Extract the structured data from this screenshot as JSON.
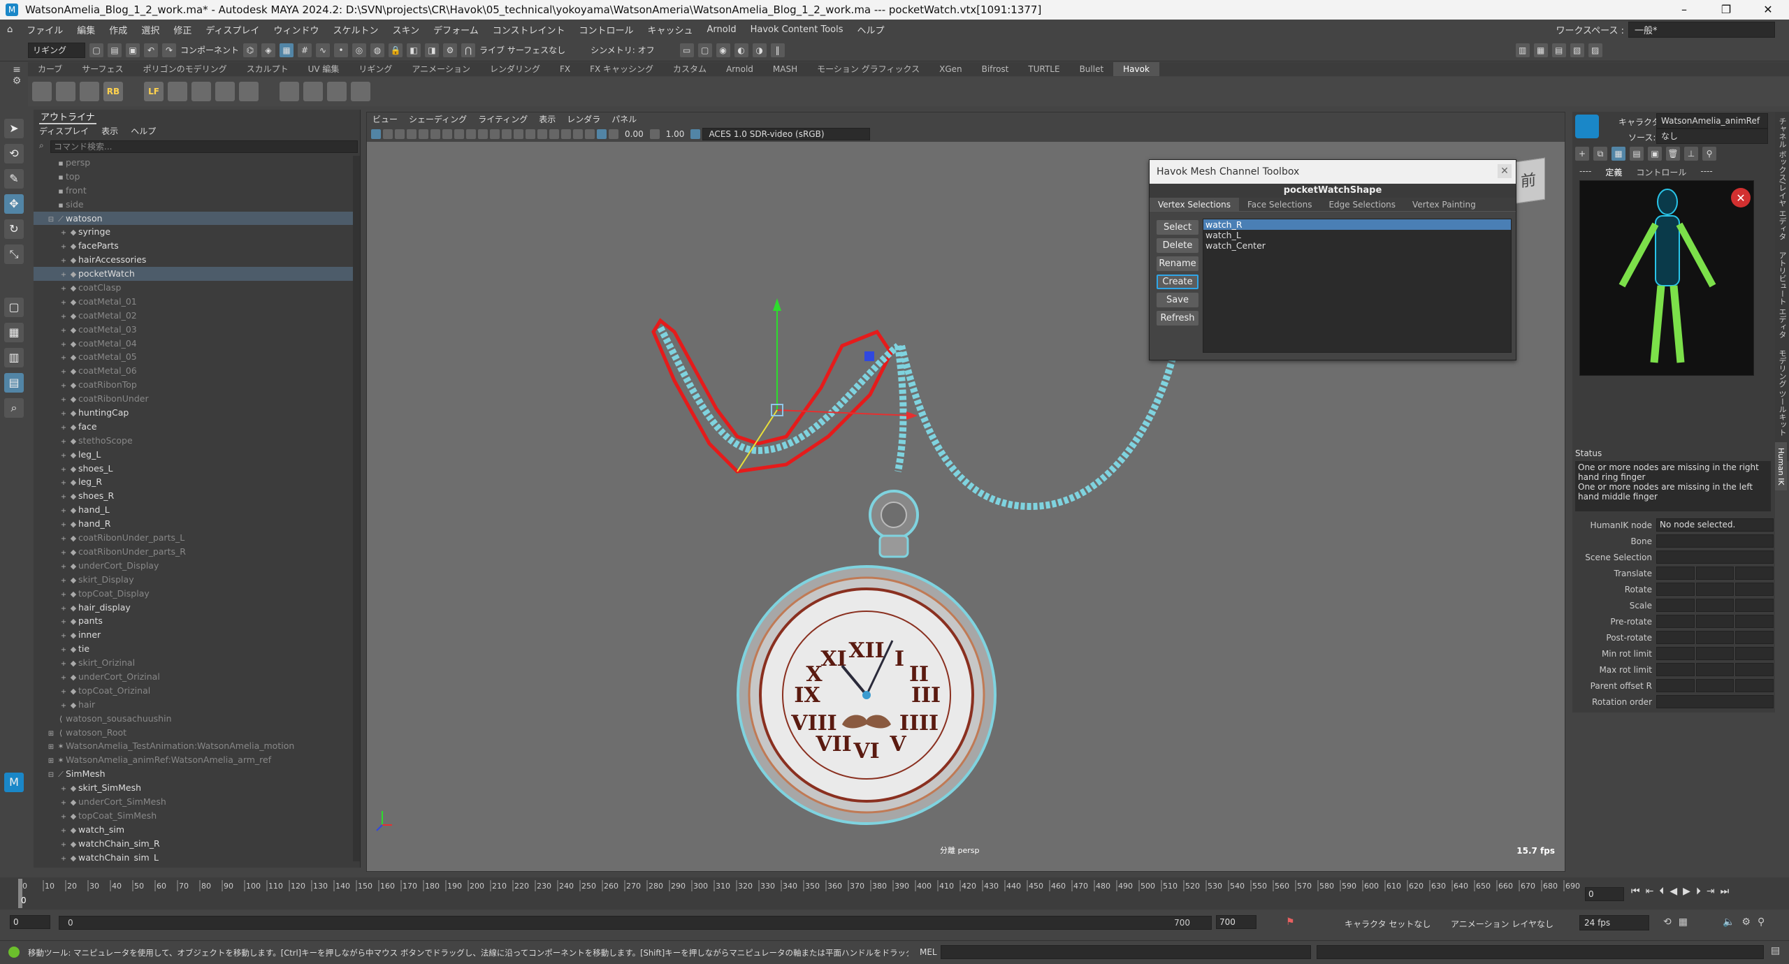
{
  "window": {
    "title": "WatsonAmelia_Blog_1_2_work.ma* - Autodesk MAYA 2024.2: D:\\SVN\\projects\\CR\\Havok\\05_technical\\yokoyama\\WatsonAmeria\\WatsonAmelia_Blog_1_2_work.ma   ---   pocketWatch.vtx[1091:1377]",
    "controls": [
      "–",
      "❐",
      "✕"
    ]
  },
  "menubar": {
    "items": [
      "ファイル",
      "編集",
      "作成",
      "選択",
      "修正",
      "ディスプレイ",
      "ウィンドウ",
      "スケルトン",
      "スキン",
      "デフォーム",
      "コンストレイント",
      "コントロール",
      "キャッシュ",
      "Arnold",
      "Havok Content Tools",
      "ヘルプ"
    ],
    "workspace_label": "ワークスペース :",
    "workspace_value": "一般*"
  },
  "statusline": {
    "mode": "リギング",
    "component_label": "コンポーネント",
    "live_surface": "ライブ サーフェスなし",
    "symmetry": "シンメトリ: オフ"
  },
  "shelf": {
    "tabs": [
      "カーブ",
      "サーフェス",
      "ポリゴンのモデリング",
      "スカルプト",
      "UV 編集",
      "リギング",
      "アニメーション",
      "レンダリング",
      "FX",
      "FX キャッシング",
      "カスタム",
      "Arnold",
      "MASH",
      "モーション グラフィックス",
      "XGen",
      "Bifrost",
      "TURTLE",
      "Bullet",
      "Havok"
    ],
    "active_tab": "Havok",
    "icons": [
      "skeleton-icon",
      "skin-icon",
      "joint-icon",
      "rb-icon",
      "lf-icon",
      "havok-icon",
      "ring-icon",
      "clip-icon",
      "chart-icon",
      "sim-icon",
      "ball-icon",
      "mesh-icon",
      "grid-icon"
    ],
    "icon_labels": [
      "RB",
      "LF"
    ]
  },
  "outliner": {
    "tab": "アウトライナ",
    "menu": [
      "ディスプレイ",
      "表示",
      "ヘルプ"
    ],
    "search_placeholder": "コマンド検索...",
    "rows": [
      {
        "label": "persp",
        "indent": 0,
        "dim": true,
        "icon": "camera",
        "exp": ""
      },
      {
        "label": "top",
        "indent": 0,
        "dim": true,
        "icon": "camera",
        "exp": ""
      },
      {
        "label": "front",
        "indent": 0,
        "dim": true,
        "icon": "camera",
        "exp": ""
      },
      {
        "label": "side",
        "indent": 0,
        "dim": true,
        "icon": "camera",
        "exp": ""
      },
      {
        "label": "watoson",
        "indent": 0,
        "dim": false,
        "icon": "joint",
        "exp": "⊟",
        "sel": true
      },
      {
        "label": "syringe",
        "indent": 1,
        "dim": false,
        "icon": "mesh",
        "exp": "+"
      },
      {
        "label": "faceParts",
        "indent": 1,
        "dim": false,
        "icon": "mesh",
        "exp": "+"
      },
      {
        "label": "hairAccessories",
        "indent": 1,
        "dim": false,
        "icon": "mesh",
        "exp": "+"
      },
      {
        "label": "pocketWatch",
        "indent": 1,
        "dim": false,
        "icon": "mesh",
        "exp": "+",
        "sel": true
      },
      {
        "label": "coatClasp",
        "indent": 1,
        "dim": true,
        "icon": "mesh",
        "exp": "+"
      },
      {
        "label": "coatMetal_01",
        "indent": 1,
        "dim": true,
        "icon": "mesh",
        "exp": "+"
      },
      {
        "label": "coatMetal_02",
        "indent": 1,
        "dim": true,
        "icon": "mesh",
        "exp": "+"
      },
      {
        "label": "coatMetal_03",
        "indent": 1,
        "dim": true,
        "icon": "mesh",
        "exp": "+"
      },
      {
        "label": "coatMetal_04",
        "indent": 1,
        "dim": true,
        "icon": "mesh",
        "exp": "+"
      },
      {
        "label": "coatMetal_05",
        "indent": 1,
        "dim": true,
        "icon": "mesh",
        "exp": "+"
      },
      {
        "label": "coatMetal_06",
        "indent": 1,
        "dim": true,
        "icon": "mesh",
        "exp": "+"
      },
      {
        "label": "coatRibonTop",
        "indent": 1,
        "dim": true,
        "icon": "mesh",
        "exp": "+"
      },
      {
        "label": "coatRibonUnder",
        "indent": 1,
        "dim": true,
        "icon": "mesh",
        "exp": "+"
      },
      {
        "label": "huntingCap",
        "indent": 1,
        "dim": false,
        "icon": "mesh",
        "exp": "+"
      },
      {
        "label": "face",
        "indent": 1,
        "dim": false,
        "icon": "mesh",
        "exp": "+"
      },
      {
        "label": "stethoScope",
        "indent": 1,
        "dim": true,
        "icon": "mesh",
        "exp": "+"
      },
      {
        "label": "leg_L",
        "indent": 1,
        "dim": false,
        "icon": "mesh",
        "exp": "+"
      },
      {
        "label": "shoes_L",
        "indent": 1,
        "dim": false,
        "icon": "mesh",
        "exp": "+"
      },
      {
        "label": "leg_R",
        "indent": 1,
        "dim": false,
        "icon": "mesh",
        "exp": "+"
      },
      {
        "label": "shoes_R",
        "indent": 1,
        "dim": false,
        "icon": "mesh",
        "exp": "+"
      },
      {
        "label": "hand_L",
        "indent": 1,
        "dim": false,
        "icon": "mesh",
        "exp": "+"
      },
      {
        "label": "hand_R",
        "indent": 1,
        "dim": false,
        "icon": "mesh",
        "exp": "+"
      },
      {
        "label": "coatRibonUnder_parts_L",
        "indent": 1,
        "dim": true,
        "icon": "mesh",
        "exp": "+"
      },
      {
        "label": "coatRibonUnder_parts_R",
        "indent": 1,
        "dim": true,
        "icon": "mesh",
        "exp": "+"
      },
      {
        "label": "underCort_Display",
        "indent": 1,
        "dim": true,
        "icon": "mesh",
        "exp": "+"
      },
      {
        "label": "skirt_Display",
        "indent": 1,
        "dim": true,
        "icon": "mesh",
        "exp": "+"
      },
      {
        "label": "topCoat_Display",
        "indent": 1,
        "dim": true,
        "icon": "mesh",
        "exp": "+"
      },
      {
        "label": "hair_display",
        "indent": 1,
        "dim": false,
        "icon": "mesh",
        "exp": "+"
      },
      {
        "label": "pants",
        "indent": 1,
        "dim": false,
        "icon": "mesh",
        "exp": "+"
      },
      {
        "label": "inner",
        "indent": 1,
        "dim": false,
        "icon": "mesh",
        "exp": "+"
      },
      {
        "label": "tie",
        "indent": 1,
        "dim": false,
        "icon": "mesh",
        "exp": "+"
      },
      {
        "label": "skirt_Orizinal",
        "indent": 1,
        "dim": true,
        "icon": "mesh",
        "exp": "+"
      },
      {
        "label": "underCort_Orizinal",
        "indent": 1,
        "dim": true,
        "icon": "mesh",
        "exp": "+"
      },
      {
        "label": "topCoat_Orizinal",
        "indent": 1,
        "dim": true,
        "icon": "mesh",
        "exp": "+"
      },
      {
        "label": "hair",
        "indent": 1,
        "dim": true,
        "icon": "mesh",
        "exp": "+"
      },
      {
        "label": "watoson_sousachuushin",
        "indent": 0,
        "dim": true,
        "icon": "curve",
        "exp": ""
      },
      {
        "label": "watoson_Root",
        "indent": 0,
        "dim": true,
        "icon": "curve",
        "exp": "⊞"
      },
      {
        "label": "WatsonAmelia_TestAnimation:WatsonAmelia_motion",
        "indent": 0,
        "dim": true,
        "icon": "star",
        "exp": "⊞"
      },
      {
        "label": "WatsonAmelia_animRef:WatsonAmelia_arm_ref",
        "indent": 0,
        "dim": true,
        "icon": "star",
        "exp": "⊞"
      },
      {
        "label": "SimMesh",
        "indent": 0,
        "dim": false,
        "icon": "joint",
        "exp": "⊟"
      },
      {
        "label": "skirt_SimMesh",
        "indent": 1,
        "dim": false,
        "icon": "mesh",
        "exp": "+"
      },
      {
        "label": "underCort_SimMesh",
        "indent": 1,
        "dim": true,
        "icon": "mesh",
        "exp": "+"
      },
      {
        "label": "topCoat_SimMesh",
        "indent": 1,
        "dim": true,
        "icon": "mesh",
        "exp": "+"
      },
      {
        "label": "watch_sim",
        "indent": 1,
        "dim": false,
        "icon": "mesh",
        "exp": "+"
      },
      {
        "label": "watchChain_sim_R",
        "indent": 1,
        "dim": false,
        "icon": "mesh",
        "exp": "+"
      },
      {
        "label": "watchChain_sim_L",
        "indent": 1,
        "dim": false,
        "icon": "mesh",
        "exp": "+"
      }
    ]
  },
  "viewport": {
    "menu": [
      "ビュー",
      "シェーディング",
      "ライティング",
      "表示",
      "レンダラ",
      "パネル"
    ],
    "exposure": "0.00",
    "gamma": "1.00",
    "color_space": "ACES 1.0 SDR-video (sRGB)",
    "camera_label": "分離  persp",
    "fps": "15.7 fps",
    "viewcube_label": "前"
  },
  "havok_toolbox": {
    "title": "Havok Mesh Channel Toolbox",
    "shape": "pocketWatchShape",
    "tabs": [
      "Vertex Selections",
      "Face Selections",
      "Edge Selections",
      "Vertex Painting"
    ],
    "active_tab": "Vertex Selections",
    "buttons": [
      "Select",
      "Delete",
      "Rename",
      "Create",
      "Save",
      "Refresh"
    ],
    "focused_button": "Create",
    "selections": [
      "watch_R",
      "watch_L",
      "watch_Center"
    ],
    "selected_item": "watch_R",
    "close_glyph": "✕"
  },
  "humanik": {
    "character_label": "キャラクタ:",
    "character_value": "WatsonAmelia_animRef",
    "source_label": "ソース:",
    "source_value": "なし",
    "tabs": [
      "定義",
      "コントロール"
    ],
    "status_label": "Status",
    "status_text": "One or more nodes are missing in the right hand ring finger\nOne or more nodes are missing in the left hand middle finger",
    "rows": [
      {
        "label": "HumanIK node",
        "value": "No node selected.",
        "cells": 1
      },
      {
        "label": "Bone",
        "value": "",
        "cells": 1
      },
      {
        "label": "Scene Selection",
        "value": "",
        "cells": 1
      },
      {
        "label": "Translate",
        "value": "",
        "cells": 3
      },
      {
        "label": "Rotate",
        "value": "",
        "cells": 3
      },
      {
        "label": "Scale",
        "value": "",
        "cells": 3
      },
      {
        "label": "Pre-rotate",
        "value": "",
        "cells": 3
      },
      {
        "label": "Post-rotate",
        "value": "",
        "cells": 3
      },
      {
        "label": "Min rot limit",
        "value": "",
        "cells": 3
      },
      {
        "label": "Max rot limit",
        "value": "",
        "cells": 3
      },
      {
        "label": "Parent offset R",
        "value": "",
        "cells": 3
      },
      {
        "label": "Rotation order",
        "value": "",
        "cells": 1
      }
    ],
    "side_tabs": [
      "チャネル ボックス/レイヤ エディタ",
      "アトリビュート エディタ",
      "モデリング ツールキット",
      "Human IK"
    ]
  },
  "timeline": {
    "ticks": [
      0,
      10,
      20,
      30,
      40,
      50,
      60,
      70,
      80,
      90,
      100,
      110,
      120,
      130,
      140,
      150,
      160,
      170,
      180,
      190,
      200,
      210,
      220,
      230,
      240,
      250,
      260,
      270,
      280,
      290,
      300,
      310,
      320,
      330,
      340,
      350,
      360,
      370,
      380,
      390,
      400,
      410,
      420,
      430,
      440,
      450,
      460,
      470,
      480,
      490,
      500,
      510,
      520,
      530,
      540,
      550,
      560,
      570,
      580,
      590,
      600,
      610,
      620,
      630,
      640,
      650,
      660,
      670,
      680,
      690
    ],
    "current_frame": "0",
    "current_marker": "0"
  },
  "range": {
    "start": "0",
    "inner_start": "0",
    "inner_end": "700",
    "end": "700",
    "char_set": "キャラクタ セットなし",
    "anim_layer": "アニメーション レイヤなし",
    "fps": "24 fps"
  },
  "helpline": {
    "text": "移動ツール: マニピュレータを使用して、オブジェクトを移動します。[Ctrl]キーを押しながら中マウス ボタンでドラッグし、法線に沿ってコンポーネントを移動します。[Shift]キーを押しながらマニピュレータの軸または平面ハンドルをドラッグして、コンポーネントやオブジェクトのクローンを押し出します。[Ctrl]-",
    "mel_label": "MEL"
  }
}
